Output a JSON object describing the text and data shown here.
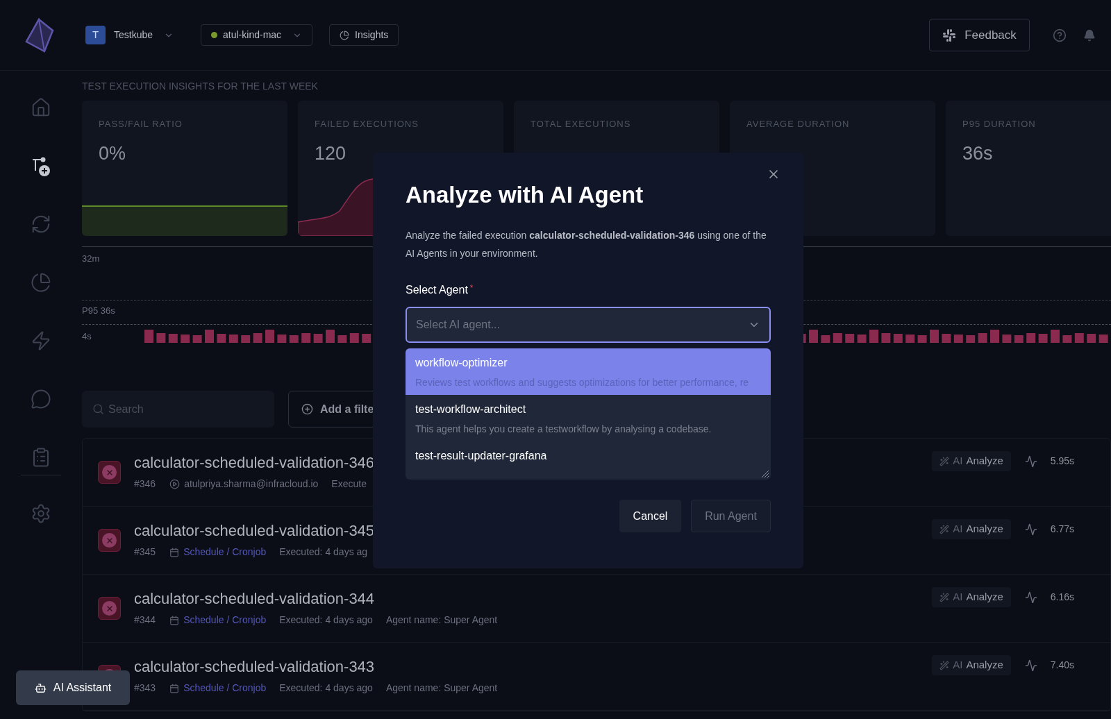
{
  "topbar": {
    "workspace": {
      "initial": "T",
      "name": "Testkube"
    },
    "environment": {
      "name": "atul-kind-mac",
      "color": "#7a9a2e"
    },
    "insights_button": "Insights",
    "feedback_button": "Feedback"
  },
  "sidebar": {
    "items": [
      {
        "kind": "home",
        "selected": false
      },
      {
        "kind": "workflows",
        "selected": true
      },
      {
        "kind": "executions",
        "selected": false
      },
      {
        "kind": "insights",
        "selected": false
      },
      {
        "kind": "triggers",
        "selected": false
      },
      {
        "kind": "assistant",
        "selected": false
      },
      {
        "kind": "reports",
        "selected": false
      },
      {
        "kind": "settings",
        "selected": false
      }
    ]
  },
  "insights": {
    "title": "TEST EXECUTION INSIGHTS FOR THE LAST WEEK",
    "cards": [
      {
        "label": "PASS/FAIL RATIO",
        "value": "0%",
        "kind": "ratio"
      },
      {
        "label": "FAILED EXECUTIONS",
        "value": "120",
        "kind": "failures"
      },
      {
        "label": "TOTAL EXECUTIONS",
        "kind": "plain"
      },
      {
        "label": "AVERAGE DURATION",
        "kind": "plain"
      },
      {
        "label": "P95 DURATION",
        "value": "36s",
        "kind": "plain"
      }
    ]
  },
  "duration_chart": {
    "max_label": "32m",
    "p95_label": "P95 36s",
    "min_label": "4s"
  },
  "filters": {
    "search_placeholder": "Search",
    "add_filter": "Add a filte"
  },
  "executions": [
    {
      "name": "calculator-scheduled-validation-346",
      "number": "#346",
      "failed": true,
      "trigger": {
        "kind": "user",
        "text": "atulpriya.sharma@infracloud.io"
      },
      "executed": "Execute",
      "ai_label": "AI",
      "ai_action": "Analyze",
      "duration": "5.95s"
    },
    {
      "name": "calculator-scheduled-validation-345",
      "number": "#345",
      "failed": true,
      "trigger": {
        "kind": "schedule",
        "text": "Schedule / Cronjob"
      },
      "executed": "Executed: 4 days ag",
      "ai_label": "AI",
      "ai_action": "Analyze",
      "duration": "6.77s"
    },
    {
      "name": "calculator-scheduled-validation-344",
      "number": "#344",
      "failed": true,
      "trigger": {
        "kind": "schedule",
        "text": "Schedule / Cronjob"
      },
      "executed": "Executed: 4 days ago",
      "agent": "Agent name: Super Agent",
      "ai_label": "AI",
      "ai_action": "Analyze",
      "duration": "6.16s"
    },
    {
      "name": "calculator-scheduled-validation-343",
      "number": "#343",
      "failed": true,
      "trigger": {
        "kind": "schedule",
        "text": "Schedule / Cronjob"
      },
      "executed": "Executed: 4 days ago",
      "agent": "Agent name: Super Agent",
      "ai_label": "AI",
      "ai_action": "Analyze",
      "duration": "7.40s"
    }
  ],
  "ai_assistant": "AI Assistant",
  "modal": {
    "title": "Analyze with AI Agent",
    "description": "Analyze the failed execution **calculator-scheduled-validation-346** using one of the AI Agents in your environment.",
    "field_label": "Select Agent",
    "required_mark": "*",
    "placeholder": "Select AI agent...",
    "options": [
      {
        "name": "workflow-optimizer",
        "description": "Reviews test workflows and suggests optimizations for better performance, re",
        "selected": true
      },
      {
        "name": "test-workflow-architect",
        "description": "This agent helps you create a testworkflow by analysing a codebase.",
        "selected": false
      },
      {
        "name": "test-result-updater-grafana",
        "selected": false
      }
    ],
    "buttons": [
      {
        "label": "Cancel",
        "kind": "secondary"
      },
      {
        "label": "Run Agent",
        "kind": "disabled"
      }
    ]
  }
}
